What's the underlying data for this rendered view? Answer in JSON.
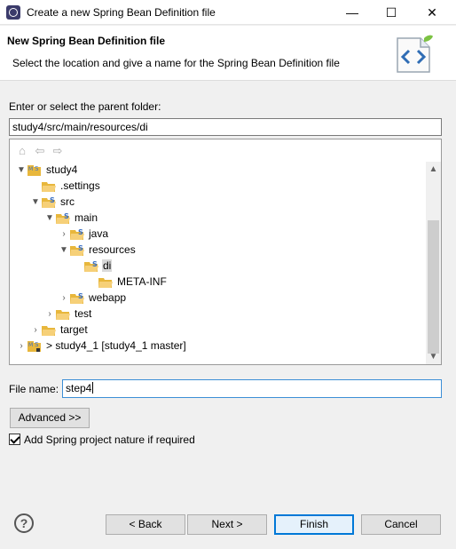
{
  "window": {
    "title": "Create a new Spring Bean Definition file",
    "minimize_glyph": "—",
    "maximize_glyph": "☐",
    "close_glyph": "✕"
  },
  "banner": {
    "heading": "New Spring Bean Definition file",
    "description": "Select the location and give a name for the Spring Bean Definition file"
  },
  "parent_folder": {
    "label": "Enter or select the parent folder:",
    "value": "study4/src/main/resources/di"
  },
  "tree_toolbar": {
    "home_glyph": "⌂",
    "back_glyph": "⇦",
    "forward_glyph": "⇨"
  },
  "tree": {
    "items": [
      {
        "label": "study4",
        "twisty": "▼",
        "icon": "project-icon"
      },
      {
        "label": ".settings",
        "twisty": "",
        "icon": "folder-icon"
      },
      {
        "label": "src",
        "twisty": "▼",
        "icon": "spring-folder-icon"
      },
      {
        "label": "main",
        "twisty": "▼",
        "icon": "spring-folder-icon"
      },
      {
        "label": "java",
        "twisty": "›",
        "icon": "spring-folder-icon"
      },
      {
        "label": "resources",
        "twisty": "▼",
        "icon": "spring-folder-icon"
      },
      {
        "label": "di",
        "twisty": "",
        "icon": "spring-folder-icon"
      },
      {
        "label": "META-INF",
        "twisty": "",
        "icon": "folder-icon"
      },
      {
        "label": "webapp",
        "twisty": "›",
        "icon": "spring-folder-icon"
      },
      {
        "label": "test",
        "twisty": "›",
        "icon": "folder-icon"
      },
      {
        "label": "target",
        "twisty": "›",
        "icon": "folder-icon"
      },
      {
        "label": "> study4_1 [study4_1 master]",
        "twisty": "›",
        "icon": "project-icon"
      }
    ]
  },
  "file_name": {
    "label": "File name:",
    "value": "step4"
  },
  "advanced_button": "Advanced >>",
  "spring_nature": {
    "label": "Add Spring project nature if required",
    "checked": true
  },
  "footer": {
    "help_glyph": "?",
    "back": "< Back",
    "next": "Next >",
    "finish": "Finish",
    "cancel": "Cancel"
  },
  "colors": {
    "accent": "#0078d7",
    "folder": "#e8b73c",
    "spring": "#3a6fc4"
  }
}
